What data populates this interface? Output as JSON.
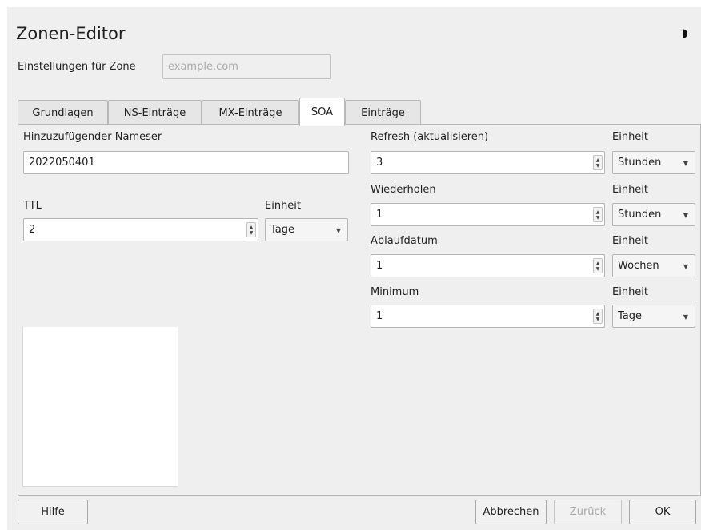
{
  "window": {
    "title": "Zonen-Editor",
    "mode_icon": "half-moon-icon",
    "glyph": "◗"
  },
  "zone": {
    "label": "Einstellungen für Zone",
    "placeholder": "example.com"
  },
  "tabs": [
    {
      "label": "Grundlagen",
      "active": false
    },
    {
      "label": "NS-Einträge",
      "active": false
    },
    {
      "label": "MX-Einträge",
      "active": false
    },
    {
      "label": "SOA",
      "active": true
    },
    {
      "label": "Einträge",
      "active": false
    }
  ],
  "soa": {
    "nameserver": {
      "label": "Hinzuzufügender Nameser",
      "value": "2022050401"
    },
    "ttl": {
      "label": "TTL",
      "value": "2",
      "unit_label": "Einheit",
      "unit": "Tage"
    },
    "refresh": {
      "label": "Refresh (aktualisieren)",
      "value": "3",
      "unit_label": "Einheit",
      "unit": "Stunden"
    },
    "retry": {
      "label": "Wiederholen",
      "value": "1",
      "unit_label": "Einheit",
      "unit": "Stunden"
    },
    "expire": {
      "label": "Ablaufdatum",
      "value": "1",
      "unit_label": "Einheit",
      "unit": "Wochen"
    },
    "minimum": {
      "label": "Minimum",
      "value": "1",
      "unit_label": "Einheit",
      "unit": "Tage"
    }
  },
  "glyphs": {
    "up": "▲",
    "down": "▼",
    "caret": "▼"
  },
  "buttons": {
    "help": "Hilfe",
    "cancel": "Abbrechen",
    "back": "Zurück",
    "ok": "OK"
  }
}
